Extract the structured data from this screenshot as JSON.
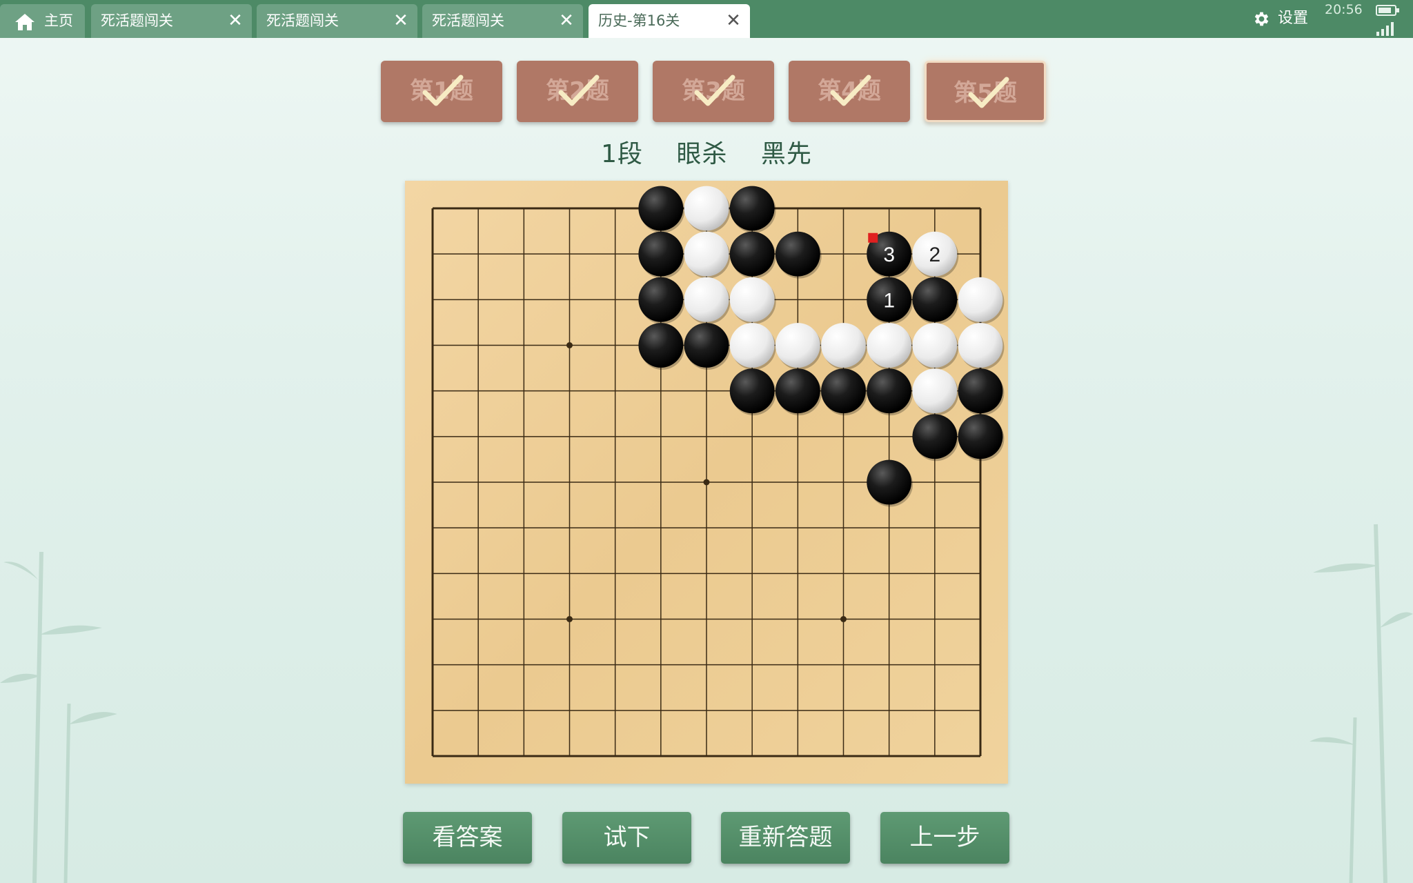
{
  "tabs": [
    {
      "label": "主页",
      "icon": "home-icon",
      "type": "home"
    },
    {
      "label": "死活题闯关",
      "closable": true
    },
    {
      "label": "死活题闯关",
      "closable": true
    },
    {
      "label": "死活题闯关",
      "closable": true
    },
    {
      "label": "历史-第16关",
      "closable": true,
      "active": true
    }
  ],
  "close_glyph": "✕",
  "settings": {
    "label": "设置",
    "icon": "gear-icon"
  },
  "status": {
    "time": "20:56",
    "battery_level": 0.8
  },
  "problems": [
    {
      "label": "第1题",
      "solved": true
    },
    {
      "label": "第2题",
      "solved": true
    },
    {
      "label": "第3题",
      "solved": true
    },
    {
      "label": "第4题",
      "solved": true
    },
    {
      "label": "第5题",
      "solved": true,
      "current": true
    }
  ],
  "problem_info": {
    "rank": "1段",
    "type": "眼杀",
    "to_play": "黑先"
  },
  "board": {
    "size": 13,
    "star_points": [
      [
        3,
        3
      ],
      [
        6,
        6
      ],
      [
        3,
        9
      ],
      [
        9,
        9
      ]
    ],
    "stones": [
      {
        "c": 5,
        "r": 0,
        "color": "black"
      },
      {
        "c": 6,
        "r": 0,
        "color": "white"
      },
      {
        "c": 7,
        "r": 0,
        "color": "black"
      },
      {
        "c": 5,
        "r": 1,
        "color": "black"
      },
      {
        "c": 6,
        "r": 1,
        "color": "white"
      },
      {
        "c": 7,
        "r": 1,
        "color": "black"
      },
      {
        "c": 8,
        "r": 1,
        "color": "black"
      },
      {
        "c": 10,
        "r": 1,
        "color": "black",
        "label": "3",
        "last": true
      },
      {
        "c": 11,
        "r": 1,
        "color": "white",
        "label": "2"
      },
      {
        "c": 5,
        "r": 2,
        "color": "black"
      },
      {
        "c": 6,
        "r": 2,
        "color": "white"
      },
      {
        "c": 7,
        "r": 2,
        "color": "white"
      },
      {
        "c": 10,
        "r": 2,
        "color": "black",
        "label": "1"
      },
      {
        "c": 11,
        "r": 2,
        "color": "black"
      },
      {
        "c": 12,
        "r": 2,
        "color": "white"
      },
      {
        "c": 5,
        "r": 3,
        "color": "black"
      },
      {
        "c": 6,
        "r": 3,
        "color": "black"
      },
      {
        "c": 7,
        "r": 3,
        "color": "white"
      },
      {
        "c": 8,
        "r": 3,
        "color": "white"
      },
      {
        "c": 9,
        "r": 3,
        "color": "white"
      },
      {
        "c": 10,
        "r": 3,
        "color": "white"
      },
      {
        "c": 11,
        "r": 3,
        "color": "white"
      },
      {
        "c": 12,
        "r": 3,
        "color": "white"
      },
      {
        "c": 7,
        "r": 4,
        "color": "black"
      },
      {
        "c": 8,
        "r": 4,
        "color": "black"
      },
      {
        "c": 9,
        "r": 4,
        "color": "black"
      },
      {
        "c": 10,
        "r": 4,
        "color": "black"
      },
      {
        "c": 11,
        "r": 4,
        "color": "white"
      },
      {
        "c": 12,
        "r": 4,
        "color": "black"
      },
      {
        "c": 11,
        "r": 5,
        "color": "black"
      },
      {
        "c": 12,
        "r": 5,
        "color": "black"
      },
      {
        "c": 10,
        "r": 6,
        "color": "black"
      }
    ]
  },
  "actions": [
    {
      "label": "看答案",
      "name": "show-answer-button"
    },
    {
      "label": "试下",
      "name": "try-move-button"
    },
    {
      "label": "重新答题",
      "name": "retry-button"
    },
    {
      "label": "上一步",
      "name": "undo-button"
    }
  ],
  "colors": {
    "accent": "#4d8a66",
    "problem_button": "#b07866",
    "board": "#efd09a"
  }
}
